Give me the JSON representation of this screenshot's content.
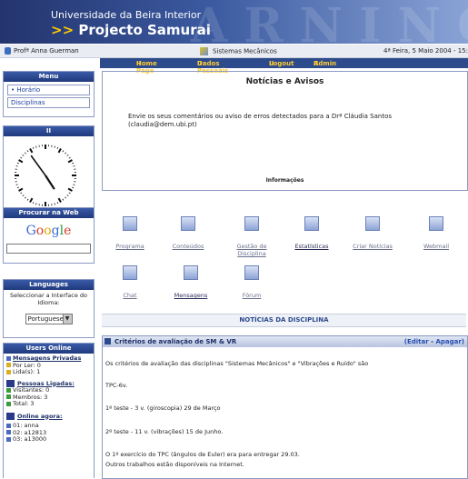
{
  "header": {
    "university": "Universidade da Beira Interior",
    "project_arrow": ">>",
    "project": "Projecto Samurai",
    "watermark": "ARNING"
  },
  "infobar": {
    "user": "Profª Anna Guerman",
    "course": "Sistemas Mecânicos",
    "date": "4ª Feira, 5 Maio 2004 - 15:"
  },
  "nav": [
    "Home Page",
    "Dados Pessoais",
    "Logout",
    "Admin"
  ],
  "nav_prefix": "II",
  "menu": {
    "title": "Menu",
    "items": [
      "• Horário",
      "Disciplinas"
    ]
  },
  "clock": {
    "title": "II",
    "hour": 4,
    "minute": 54
  },
  "search": {
    "title": "Procurar na Web",
    "logo": "Google"
  },
  "languages": {
    "title": "Languages",
    "text": "Seleccionar a Interface do Idioma:",
    "selected": "Portuguese"
  },
  "users_online": {
    "title": "Users Online",
    "private_messages": "Mensagens Privadas",
    "unread": "Por Ler: 0",
    "read": "Lida(s): 1",
    "connected_title": "Pessoas Ligadas:",
    "visitors": "Visitantes: 0",
    "members": "Membros: 3",
    "total": "Total: 3",
    "online_now": "Online agora:",
    "list": [
      "01: anna",
      "02: a12813",
      "03: a13000"
    ]
  },
  "news": {
    "title": "Notícias e Avisos",
    "message": "Envie os seus comentários ou aviso de erros detectados para a Drª Cláudia Santos (claudia@dem.ubi.pt)",
    "info": "Informações"
  },
  "tools": [
    {
      "label": "Programa"
    },
    {
      "label": "Conteúdos"
    },
    {
      "label": "Gestão de Disciplina"
    },
    {
      "label": "Estatísticas"
    },
    {
      "label": "Criar Notícias"
    },
    {
      "label": "Webmail"
    },
    {
      "label": "Chat"
    },
    {
      "label": "Mensagens"
    },
    {
      "label": "Fórum"
    }
  ],
  "disc_news": "NOTÍCIAS DA DISCIPLINA",
  "criteria": {
    "title": "Critérios de avaliação de SM & VR",
    "edit": "Editar",
    "delete": "Apagar",
    "lines": [
      "Os critérios de avaliação das disciplinas \"Sistemas Mecânicos\" e \"Vibrações e Ruído\" são",
      "TPC-6v.",
      "1º teste - 3 v. (giroscopia)     29 de Março",
      "2º teste - 11 v. (vibrações)     15 de Junho.",
      "O 1º exercício do TPC (ângulos de Euler) era para entregar 29.03.",
      "Outros trabalhos  estão disponíveis na Internet."
    ]
  },
  "colors": {
    "primary": "#2d4a8c",
    "accent": "#ffcc33"
  }
}
